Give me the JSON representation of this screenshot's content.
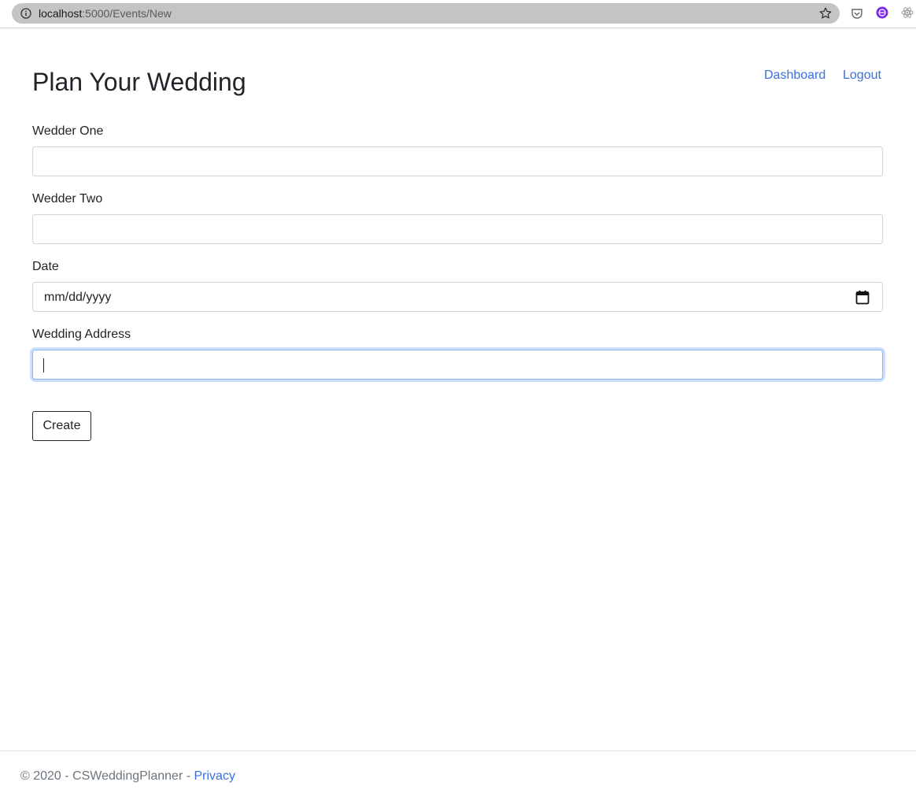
{
  "browser": {
    "url_host": "localhost",
    "url_path": ":5000/Events/New"
  },
  "header": {
    "title": "Plan Your Wedding",
    "nav": {
      "dashboard": "Dashboard",
      "logout": "Logout"
    }
  },
  "form": {
    "wedder_one": {
      "label": "Wedder One",
      "value": ""
    },
    "wedder_two": {
      "label": "Wedder Two",
      "value": ""
    },
    "date": {
      "label": "Date",
      "placeholder": "mm/dd/yyyy"
    },
    "address": {
      "label": "Wedding Address",
      "value": ""
    },
    "submit_label": "Create"
  },
  "footer": {
    "text": "© 2020 - CSWeddingPlanner - ",
    "privacy_link": "Privacy"
  },
  "colors": {
    "link": "#3b6fe0",
    "focus_ring": "#86b7fe"
  }
}
